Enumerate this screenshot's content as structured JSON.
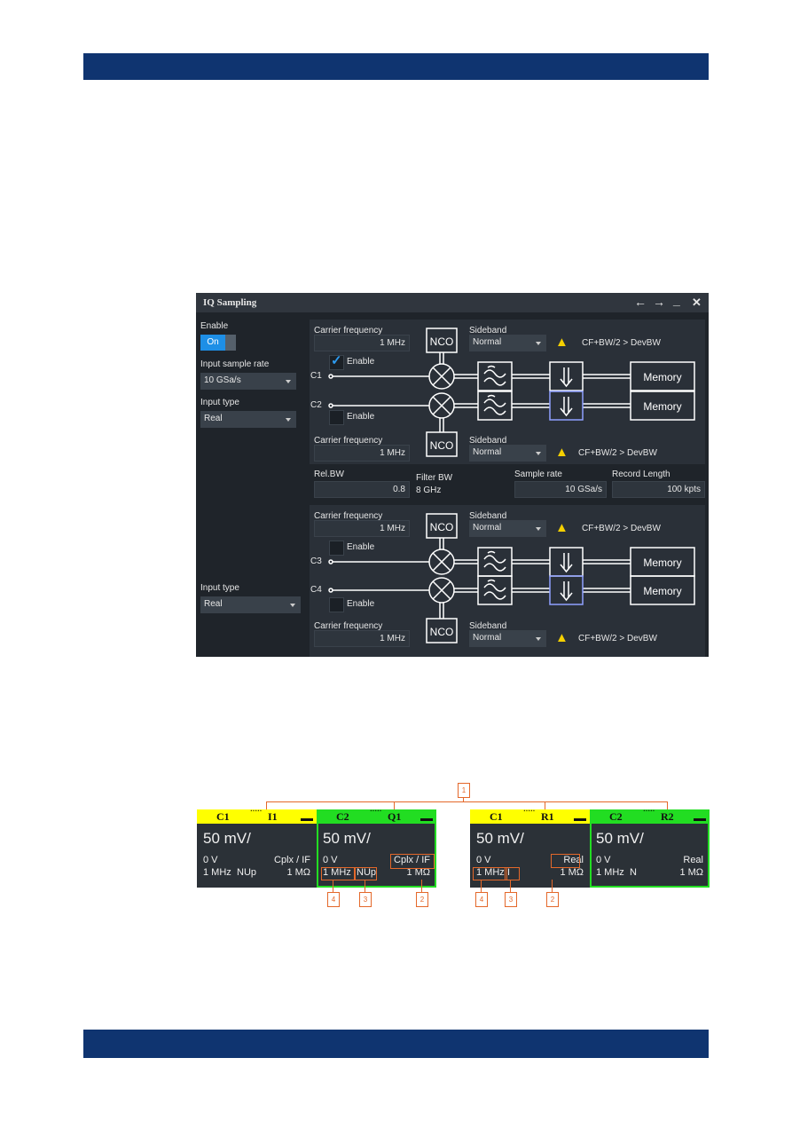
{
  "dialog": {
    "title": "IQ Sampling",
    "controls": {
      "back": "←",
      "forward": "→",
      "minimize": "_",
      "close": "✕"
    },
    "left": {
      "enable_label": "Enable",
      "toggle_label": "On",
      "toggle_on": true,
      "sample_rate_label": "Input sample rate",
      "sample_rate_value": "10 GSa/s",
      "input_type_label": "Input type",
      "input_type_value": "Real",
      "input_type2_label": "Input type",
      "input_type2_value": "Real"
    },
    "panels": [
      {
        "upper": {
          "carrier_label": "Carrier frequency",
          "carrier_value": "1 MHz",
          "sideband_label": "Sideband",
          "sideband_value": "Normal",
          "warning": "CF+BW/2 > DevBW",
          "enable_label": "Enable",
          "enabled": true,
          "channel": "C1"
        },
        "lower": {
          "carrier_label": "Carrier frequency",
          "carrier_value": "1 MHz",
          "sideband_label": "Sideband",
          "sideband_value": "Normal",
          "warning": "CF+BW/2 > DevBW",
          "enable_label": "Enable",
          "enabled": false,
          "channel": "C2"
        }
      },
      {
        "upper": {
          "carrier_label": "Carrier frequency",
          "carrier_value": "1 MHz",
          "sideband_label": "Sideband",
          "sideband_value": "Normal",
          "warning": "CF+BW/2 > DevBW",
          "enable_label": "Enable",
          "enabled": false,
          "channel": "C3"
        },
        "lower": {
          "carrier_label": "Carrier frequency",
          "carrier_value": "1 MHz",
          "sideband_label": "Sideband",
          "sideband_value": "Normal",
          "warning": "CF+BW/2 > DevBW",
          "enable_label": "Enable",
          "enabled": false,
          "channel": "C4"
        }
      }
    ],
    "blocks": {
      "nco": "NCO",
      "memory": "Memory"
    },
    "middle": {
      "relbw_label": "Rel.BW",
      "relbw_value": "0.8",
      "filterbw_label": "Filter BW",
      "filterbw_value": "8 GHz",
      "samplerate_label": "Sample rate",
      "samplerate_value": "10 GSa/s",
      "record_label": "Record Length",
      "record_value": "100 kpts"
    }
  },
  "channel_labels": [
    {
      "src": "C1",
      "name": "I1",
      "scale": "50 mV/",
      "offset": "0 V",
      "mode": "Cplx / IF",
      "freq": "1 MHz",
      "side": "NUp",
      "imp": "1 MΩ",
      "color": "#ffff00"
    },
    {
      "src": "C2",
      "name": "Q1",
      "scale": "50 mV/",
      "offset": "0 V",
      "mode": "Cplx / IF",
      "freq": "1 MHz",
      "side": "NUp",
      "imp": "1 MΩ",
      "color": "#22dd22"
    },
    {
      "src": "C1",
      "name": "R1",
      "scale": "50 mV/",
      "offset": "0 V",
      "mode": "Real",
      "freq": "1 MHz",
      "side": "I",
      "imp": "1 MΩ",
      "color": "#ffff00"
    },
    {
      "src": "C2",
      "name": "R2",
      "scale": "50 mV/",
      "offset": "0 V",
      "mode": "Real",
      "freq": "1 MHz",
      "side": "N",
      "imp": "1 MΩ",
      "color": "#22dd22"
    }
  ],
  "callouts": [
    "1",
    "2",
    "3",
    "4"
  ],
  "colors": {
    "band": "#0f3470",
    "accent": "#1e8fe6",
    "callout": "#e4682a",
    "warning": "#f5d000"
  }
}
